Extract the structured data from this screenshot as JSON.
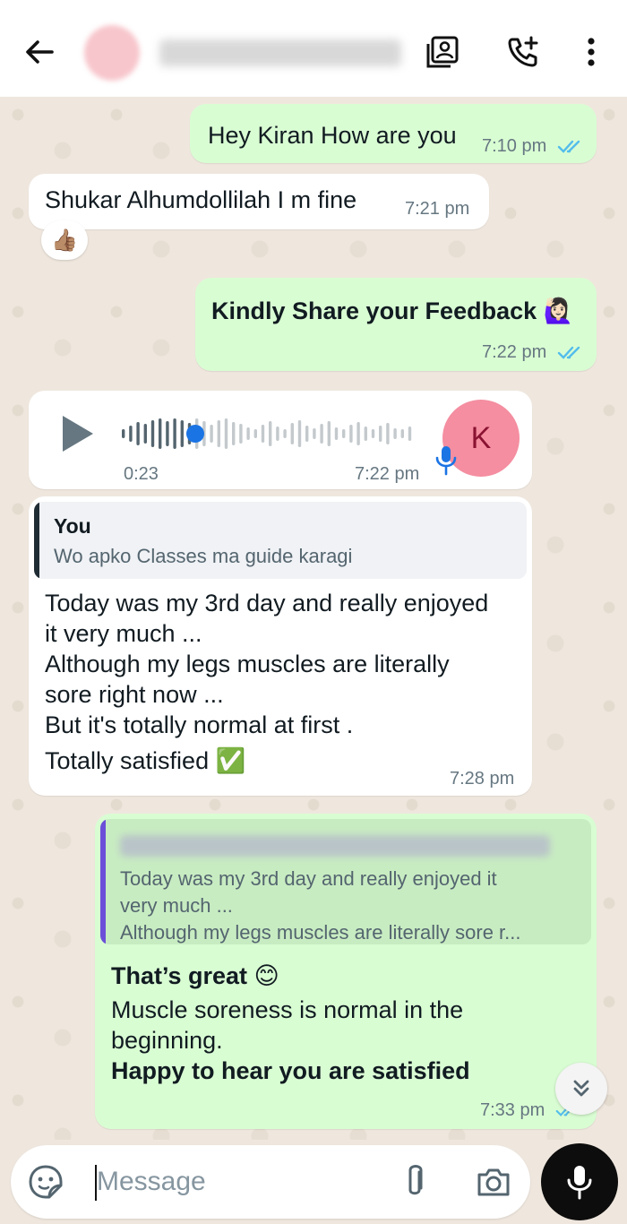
{
  "header": {
    "contact_initial": "K"
  },
  "messages": [
    {
      "text": "Hey Kiran How are you",
      "time": "7:10 pm"
    },
    {
      "text": "Shukar Alhumdollilah I m fine",
      "time": "7:21 pm",
      "reaction": "👍🏽"
    },
    {
      "text": "Kindly Share your Feedback",
      "emoji": "🙋🏻‍♀️",
      "time": "7:22 pm"
    },
    {
      "duration": "0:23",
      "time": "7:22 pm",
      "avatar_initial": "K",
      "progress": 0.25
    },
    {
      "quote_name": "You",
      "quote_text": "Wo apko Classes ma guide karagi",
      "lines": [
        "Today was my 3rd day and really enjoyed",
        "it very much ...",
        "Although my legs muscles are literally",
        "sore right now ...",
        "But it's totally normal at first ."
      ],
      "last_line": "Totally satisfied",
      "last_emoji": "✅",
      "time": "7:28 pm"
    },
    {
      "quote_lines": [
        "Today was my 3rd day and really enjoyed it",
        "very much ...",
        "Although my legs muscles are literally sore r..."
      ],
      "title": "That’s great",
      "title_emoji": "😊",
      "body_lines": [
        "Muscle soreness is normal in the",
        "beginning."
      ],
      "closing": "Happy to hear you are satisfied",
      "time": "7:33 pm"
    }
  ],
  "composer": {
    "placeholder": "Message"
  },
  "colors": {
    "outgoing": "#d9fdd3",
    "incoming": "#ffffff",
    "tick_blue": "#53bdeb",
    "voice_dot": "#1b74e4",
    "avatar_pink": "#f48ea0",
    "quote_bar_dark": "#202c33",
    "quote_bar_purple": "#6b4fd8"
  },
  "icons": {
    "back": "arrow-left-icon",
    "contact_card": "contact-card-icon",
    "add_call": "add-call-icon",
    "menu": "more-vert-icon",
    "sticker": "sticker-icon",
    "attach": "paperclip-icon",
    "camera": "camera-icon",
    "mic": "mic-icon",
    "play": "play-icon"
  }
}
